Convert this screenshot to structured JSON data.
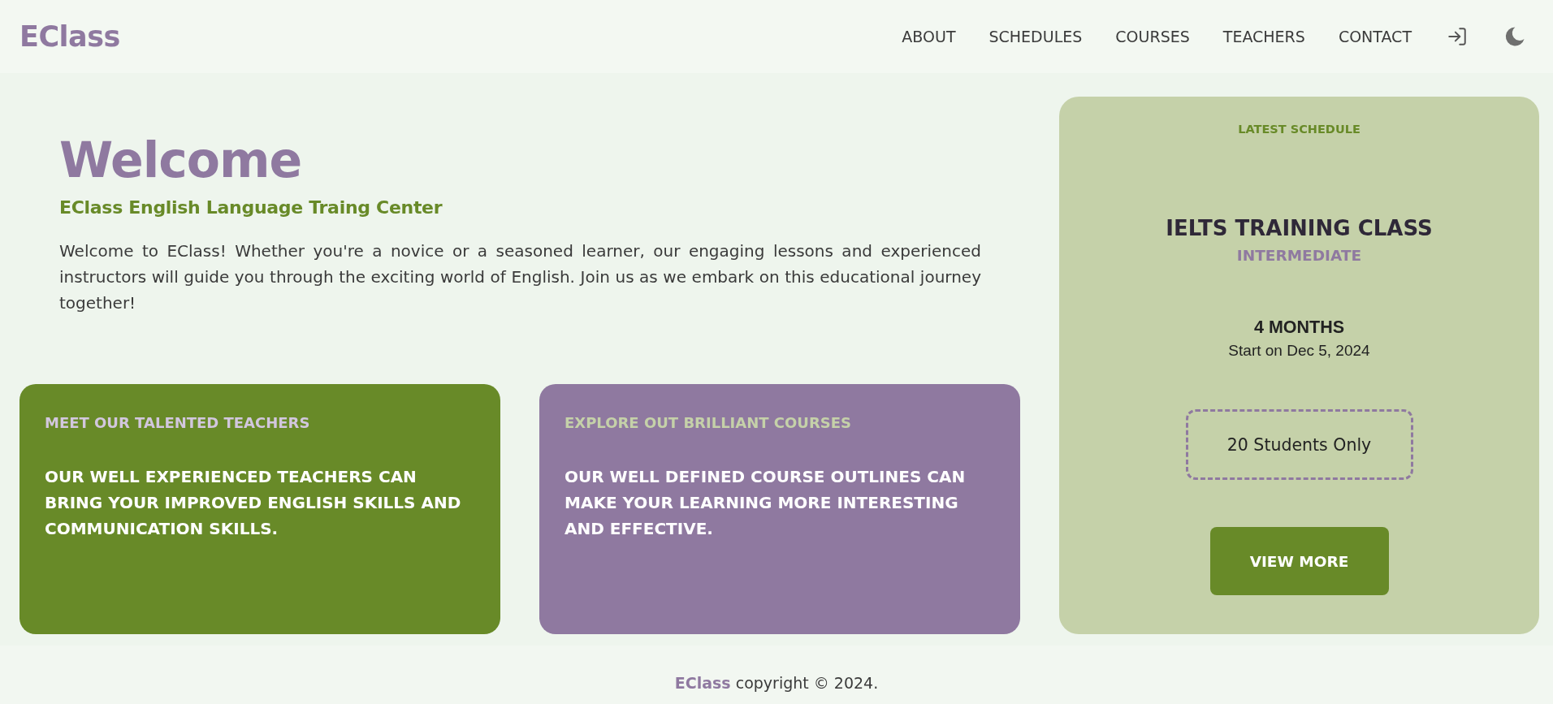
{
  "header": {
    "logo": "EClass",
    "nav": [
      "ABOUT",
      "SCHEDULES",
      "COURSES",
      "TEACHERS",
      "CONTACT"
    ]
  },
  "hero": {
    "title": "Welcome",
    "subtitle": "EClass English Language Traing Center",
    "description": "Welcome to EClass! Whether you're a novice or a seasoned learner, our engaging lessons and experienced instructors will guide you through the exciting world of English. Join us as we embark on this educational journey together!"
  },
  "feature_cards": [
    {
      "title": "MEET OUR TALENTED TEACHERS",
      "text": "OUR WELL EXPERIENCED TEACHERS CAN BRING YOUR IMPROVED ENGLISH SKILLS AND COMMUNICATION SKILLS.",
      "color": "#688a28"
    },
    {
      "title": "EXPLORE OUT BRILLIANT COURSES",
      "text": "OUR WELL DEFINED COURSE OUTLINES CAN MAKE YOUR LEARNING MORE INTERESTING AND EFFECTIVE.",
      "color": "#8f79a0"
    }
  ],
  "schedule": {
    "heading": "LATEST SCHEDULE",
    "course": "IELTS TRAINING CLASS",
    "course_level": "INTERMEDIATE",
    "duration": "4 MONTHS",
    "start": "Start on Dec 5, 2024",
    "capacity": "20 Students Only",
    "button": "VIEW MORE"
  },
  "footer": {
    "text": "**EClass** copyright © 2024."
  }
}
